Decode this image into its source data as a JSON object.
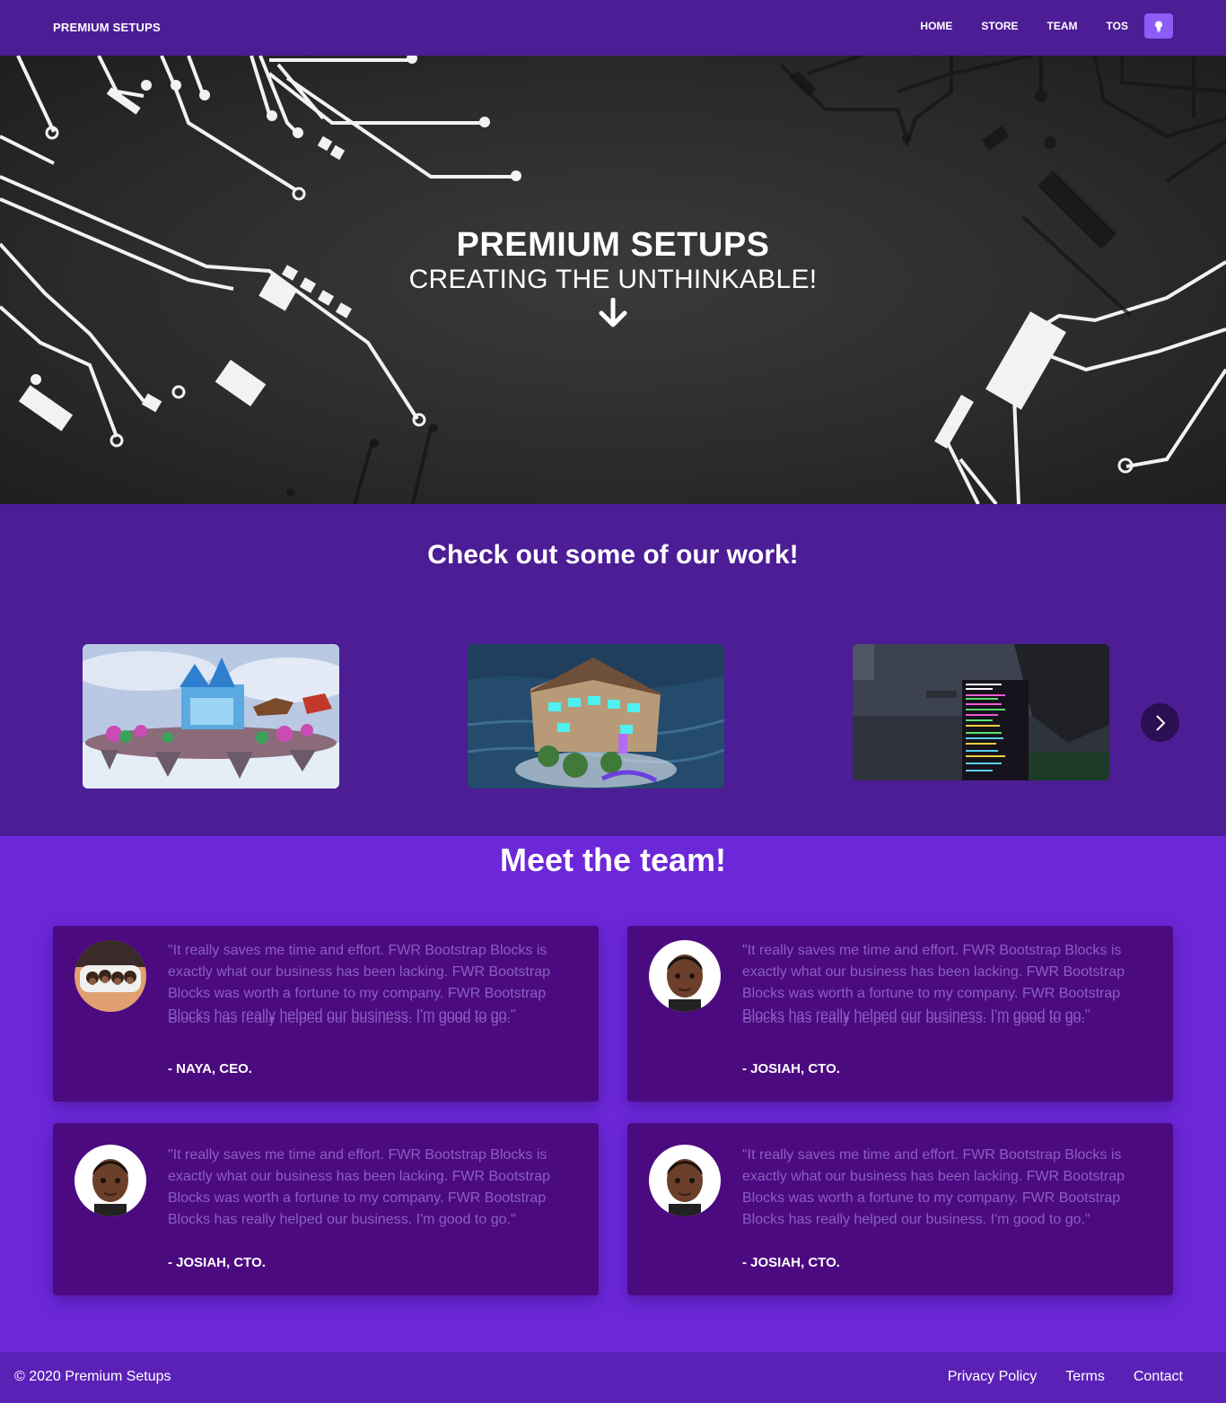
{
  "nav": {
    "brand": "PREMIUM SETUPS",
    "links": [
      "HOME",
      "STORE",
      "TEAM",
      "TOS"
    ],
    "theme_icon": "lightbulb-icon"
  },
  "hero": {
    "title": "PREMIUM SETUPS",
    "subtitle": "CREATING THE UNTHINKABLE!",
    "arrow_icon": "arrow-down-icon"
  },
  "work": {
    "title": "Check out some of our work!",
    "next_icon": "chevron-right-icon"
  },
  "team": {
    "title": "Meet the team!",
    "members": [
      {
        "quote": "\"It really saves me time and effort. FWR Bootstrap Blocks is exactly what our business has been lacking. FWR Bootstrap Blocks was worth a fortune to my company. FWR Bootstrap Blocks has really helped our business. I'm good to go.\"",
        "author": "- NAYA, CEO."
      },
      {
        "quote": "\"It really saves me time and effort. FWR Bootstrap Blocks is exactly what our business has been lacking. FWR Bootstrap Blocks was worth a fortune to my company. FWR Bootstrap Blocks has really helped our business. I'm good to go.\"",
        "author": "- JOSIAH, CTO."
      },
      {
        "quote": "\"It really saves me time and effort. FWR Bootstrap Blocks is exactly what our business has been lacking. FWR Bootstrap Blocks was worth a fortune to my company. FWR Bootstrap Blocks has really helped our business. I'm good to go.\"",
        "author": "- JOSIAH, CTO."
      },
      {
        "quote": "\"It really saves me time and effort. FWR Bootstrap Blocks is exactly what our business has been lacking. FWR Bootstrap Blocks was worth a fortune to my company. FWR Bootstrap Blocks has really helped our business. I'm good to go.\"",
        "author": "- JOSIAH, CTO."
      }
    ]
  },
  "footer": {
    "copyright": "© 2020 Premium Setups",
    "links": [
      "Privacy Policy",
      "Terms",
      "Contact"
    ]
  },
  "colors": {
    "nav_bg": "#4c1d95",
    "page_bg": "#6c27d9",
    "card_bg": "#4c0a80",
    "accent": "#8b5cf6",
    "footer_bg": "#5b21b6"
  }
}
